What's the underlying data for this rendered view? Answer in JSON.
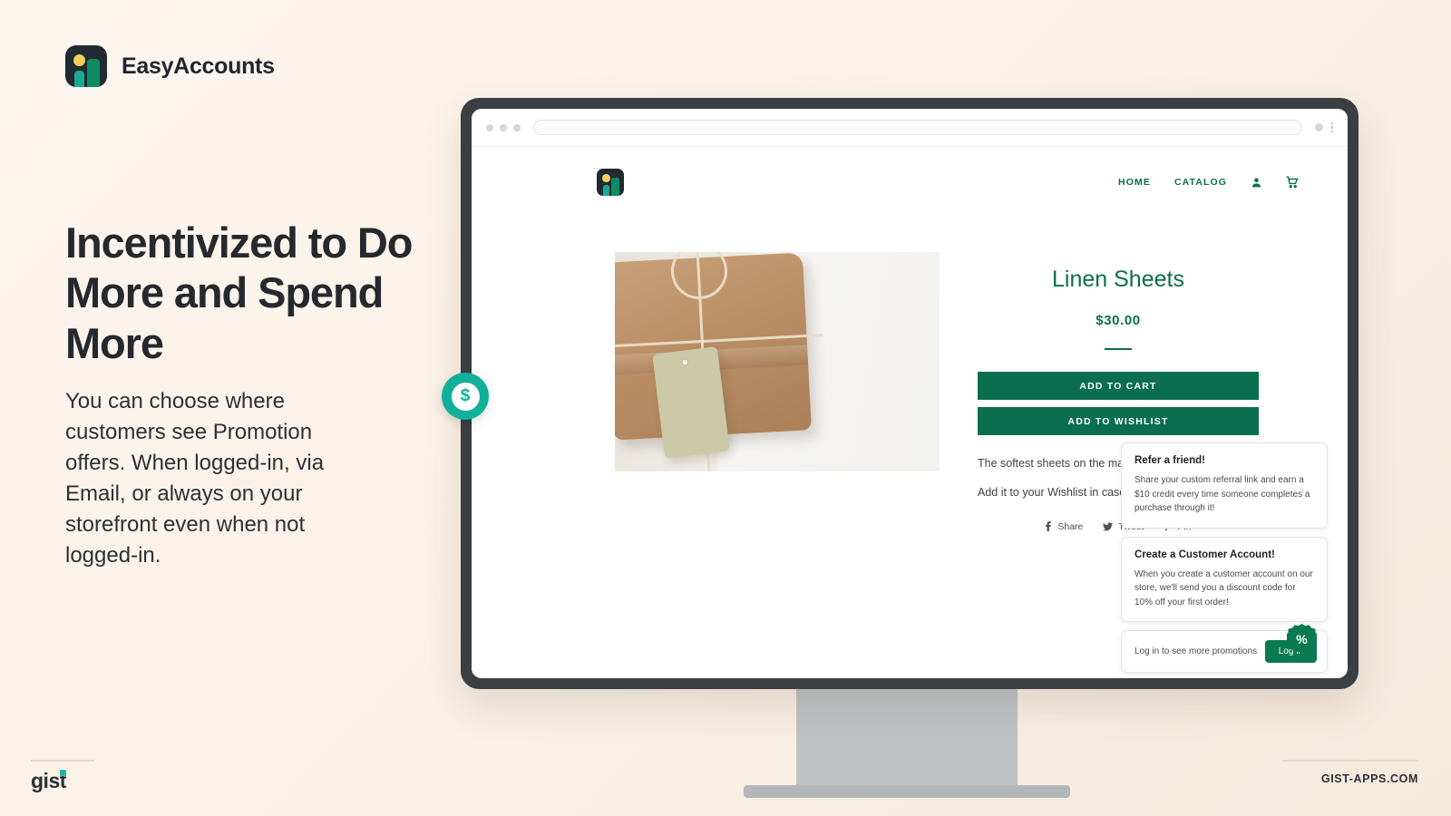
{
  "brand": {
    "name": "EasyAccounts",
    "logo_icon": "easyaccounts-logo-icon"
  },
  "hero": {
    "headline": "Incentivized to Do More and Spend More",
    "body": "You can choose where customers see Promotion offers. When logged-in, via Email, or always on your storefront even when not logged-in."
  },
  "footer": {
    "logo_text": "gist",
    "url": "GIST-APPS.COM"
  },
  "browser": {
    "url_value": "",
    "url_placeholder": ""
  },
  "store": {
    "nav": {
      "home": "HOME",
      "catalog": "CATALOG",
      "account_icon": "user-account-icon",
      "cart_icon": "shopping-cart-icon"
    },
    "product": {
      "image_alt": "wrapped-parcel-with-hang-tag",
      "title": "Linen Sheets",
      "price": "$30.00",
      "add_to_cart": "ADD TO CART",
      "add_to_wishlist": "ADD TO WISHLIST",
      "description_1": "The softest sheets on the market!",
      "description_2": "Add it to your Wishlist in case you want to buy it later.",
      "share": {
        "facebook_icon": "facebook-icon",
        "facebook_label": "Share",
        "twitter_icon": "twitter-icon",
        "twitter_label": "Tweet",
        "pinterest_icon": "pinterest-icon",
        "pinterest_label": "Pin"
      }
    },
    "promotions": [
      {
        "title": "Refer a friend!",
        "body": "Share your custom referral link and earn a $10 credit every time someone completes a purchase through it!"
      },
      {
        "title": "Create a Customer Account!",
        "body": "When you create a customer account on our store, we'll send you a discount code for 10% off your first order!"
      }
    ],
    "login_prompt": {
      "text": "Log in to see more promotions",
      "button_label": "Log in"
    },
    "badges": {
      "dollar_icon": "dollar-coin-badge-icon",
      "dollar_glyph": "$",
      "percent_icon": "discount-percent-badge-icon",
      "percent_glyph": "%"
    }
  },
  "colors": {
    "background": "#fbf1e7",
    "brand_dark": "#1f2a33",
    "store_green": "#0b6e4f",
    "accent_teal": "#12b09a",
    "logo_yellow": "#f2cf5f"
  }
}
